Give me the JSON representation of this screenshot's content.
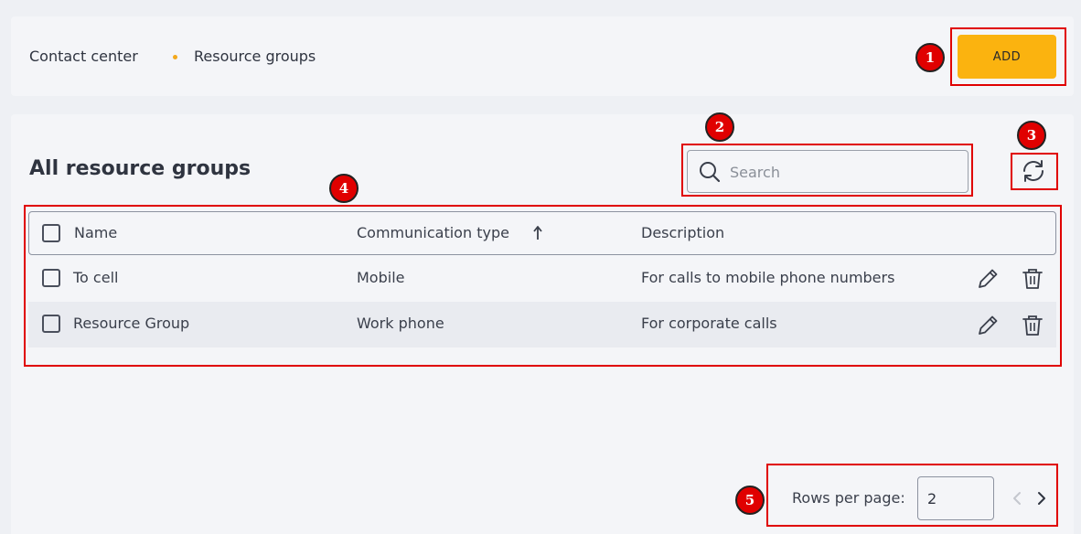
{
  "breadcrumb": {
    "items": [
      "Contact center",
      "Resource groups"
    ]
  },
  "actions": {
    "add_label": "ADD"
  },
  "main": {
    "title": "All resource groups",
    "search": {
      "placeholder": "Search",
      "value": ""
    }
  },
  "table": {
    "columns": [
      "Name",
      "Communication type",
      "Description"
    ],
    "sort": {
      "column": "Communication type",
      "direction": "ascending"
    },
    "rows": [
      {
        "name": "To cell",
        "type": "Mobile",
        "description": "For calls to mobile phone numbers"
      },
      {
        "name": "Resource Group",
        "type": "Work phone",
        "description": "For corporate calls"
      }
    ]
  },
  "pagination": {
    "rows_per_page_label": "Rows per page:",
    "rows_per_page_value": "2"
  },
  "annotations": [
    "1",
    "2",
    "3",
    "4",
    "5"
  ],
  "colors": {
    "accent": "#fbb30f",
    "annotation": "#e00000",
    "breadcrumb_dot": "#f3a81c"
  },
  "icons": [
    "search-icon",
    "refresh-icon",
    "sort-arrow-up-icon",
    "edit-icon",
    "delete-icon",
    "chevron-left-icon",
    "chevron-right-icon"
  ]
}
